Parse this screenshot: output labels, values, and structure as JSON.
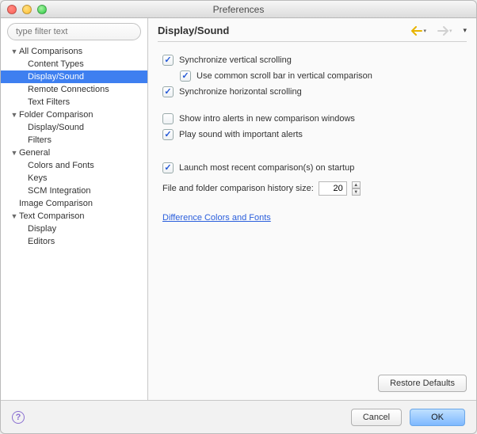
{
  "window": {
    "title": "Preferences"
  },
  "filter": {
    "placeholder": "type filter text"
  },
  "tree": [
    {
      "label": "All Comparisons",
      "level": 1,
      "expanded": true
    },
    {
      "label": "Content Types",
      "level": 2
    },
    {
      "label": "Display/Sound",
      "level": 2,
      "selected": true
    },
    {
      "label": "Remote Connections",
      "level": 2
    },
    {
      "label": "Text Filters",
      "level": 2
    },
    {
      "label": "Folder Comparison",
      "level": 1,
      "expanded": true
    },
    {
      "label": "Display/Sound",
      "level": 2
    },
    {
      "label": "Filters",
      "level": 2
    },
    {
      "label": "General",
      "level": 1,
      "expanded": true
    },
    {
      "label": "Colors and Fonts",
      "level": 2
    },
    {
      "label": "Keys",
      "level": 2
    },
    {
      "label": "SCM Integration",
      "level": 2
    },
    {
      "label": "Image Comparison",
      "level": 1,
      "expanded": false,
      "leaf": true
    },
    {
      "label": "Text Comparison",
      "level": 1,
      "expanded": true
    },
    {
      "label": "Display",
      "level": 2
    },
    {
      "label": "Editors",
      "level": 2
    }
  ],
  "page": {
    "title": "Display/Sound",
    "sync_vert": {
      "label": "Synchronize vertical scrolling",
      "checked": true
    },
    "common_scroll": {
      "label": "Use common scroll bar in vertical comparison",
      "checked": true
    },
    "sync_horiz": {
      "label": "Synchronize horizontal scrolling",
      "checked": true
    },
    "intro_alerts": {
      "label": "Show intro alerts in new comparison windows",
      "checked": false
    },
    "play_sound": {
      "label": "Play sound with important alerts",
      "checked": true
    },
    "launch_recent": {
      "label": "Launch most recent comparison(s) on startup",
      "checked": true
    },
    "history_label": "File and folder comparison history size:",
    "history_value": "20",
    "link": "Difference Colors and Fonts",
    "restore": "Restore Defaults"
  },
  "footer": {
    "cancel": "Cancel",
    "ok": "OK"
  }
}
